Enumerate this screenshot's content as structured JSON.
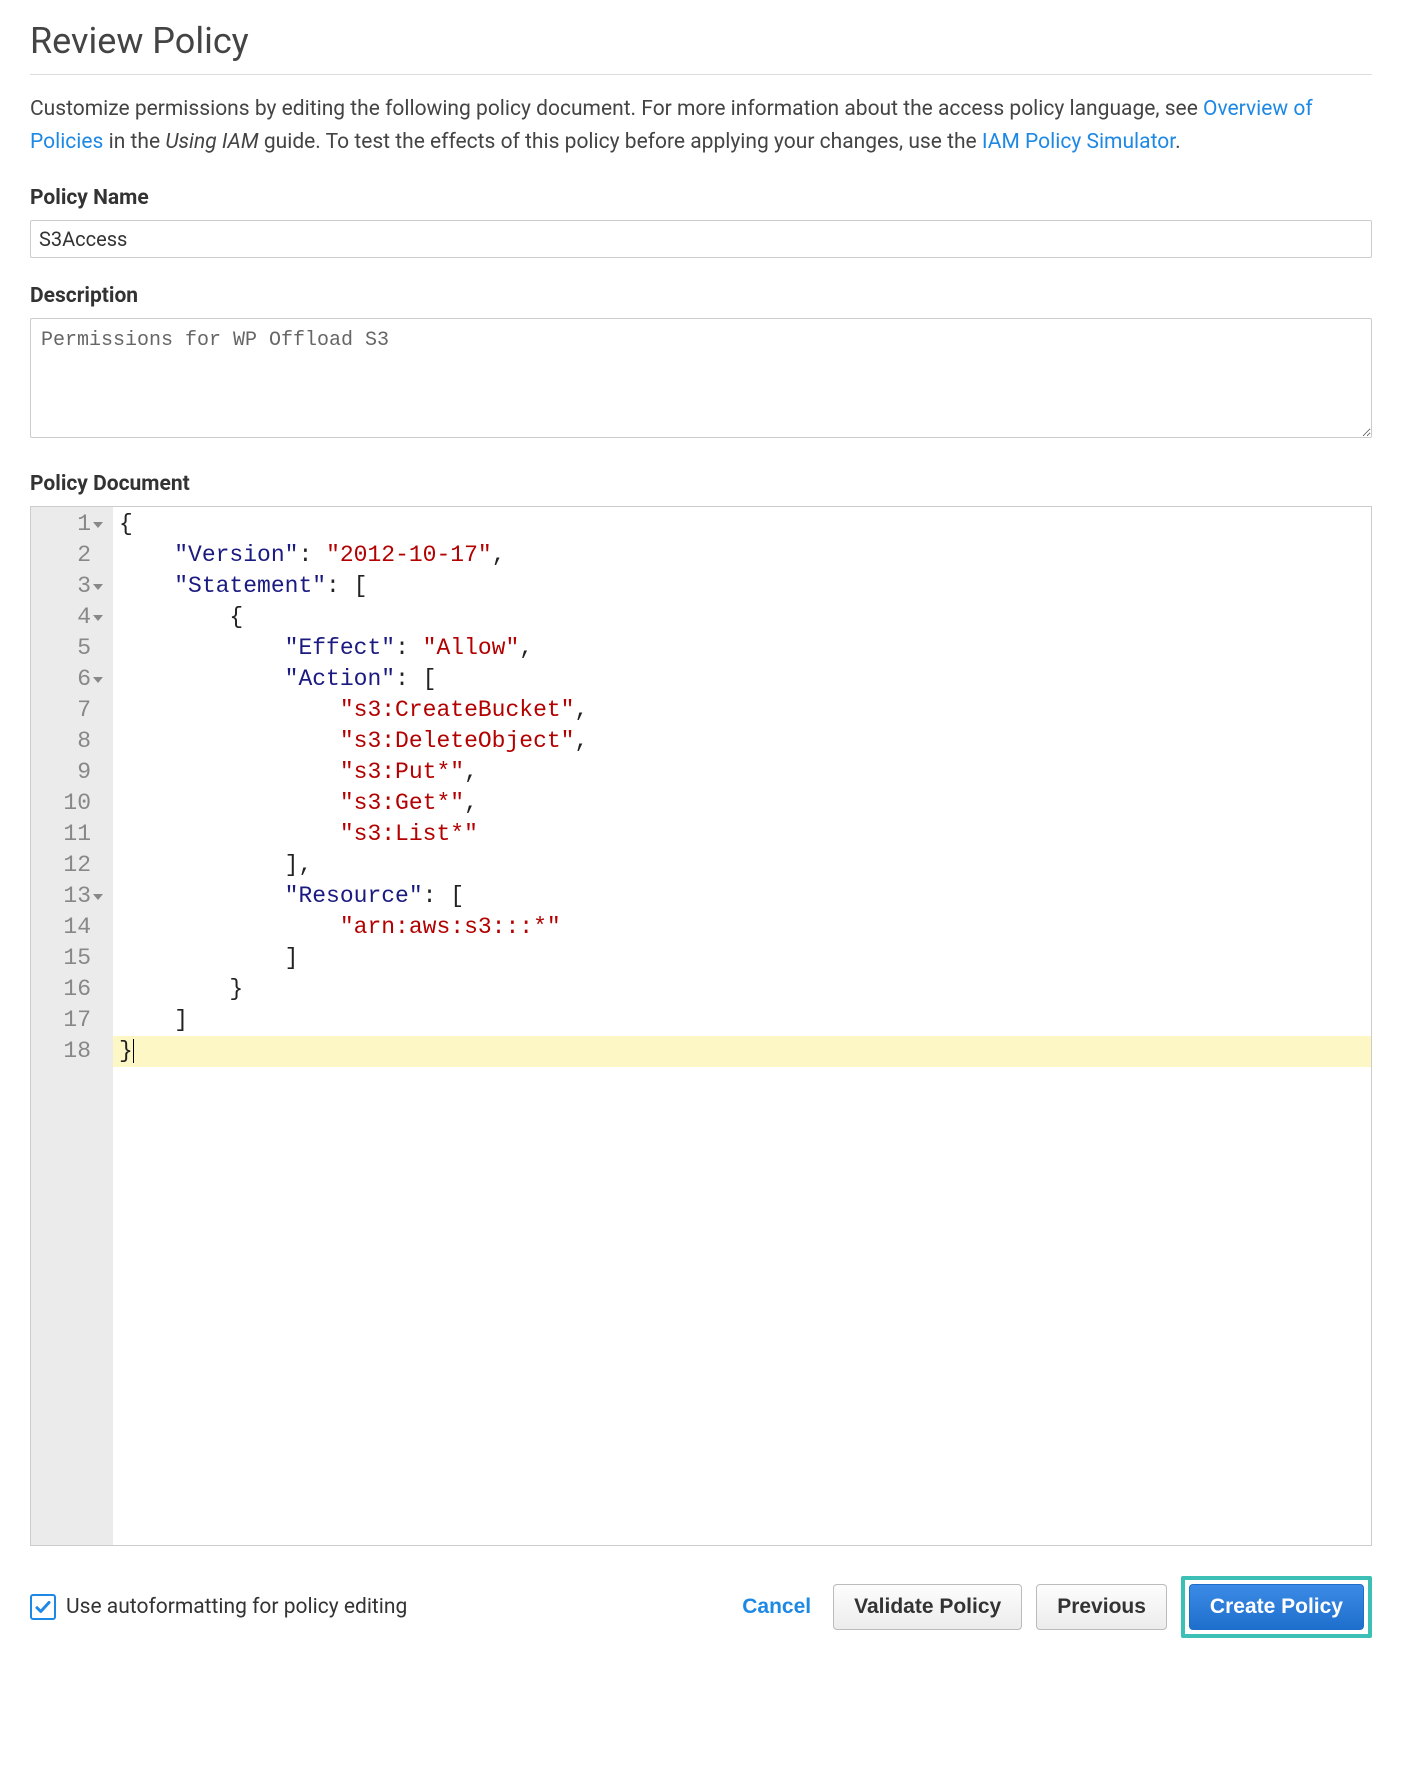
{
  "title": "Review Policy",
  "intro": {
    "text1": "Customize permissions by editing the following policy document. For more information about the access policy language, see ",
    "link1": "Overview of Policies",
    "text2": " in the ",
    "guide": "Using IAM",
    "text3": " guide. To test the effects of this policy before applying your changes, use the ",
    "link2": "IAM Policy Simulator",
    "text4": "."
  },
  "policyName": {
    "label": "Policy Name",
    "value": "S3Access"
  },
  "description": {
    "label": "Description",
    "value": "Permissions for WP Offload S3"
  },
  "policyDocument": {
    "label": "Policy Document",
    "lines": [
      {
        "n": 1,
        "fold": true,
        "tokens": [
          [
            "punc",
            "{"
          ]
        ]
      },
      {
        "n": 2,
        "fold": false,
        "tokens": [
          [
            "ws",
            "    "
          ],
          [
            "key",
            "\"Version\""
          ],
          [
            "punc",
            ": "
          ],
          [
            "str",
            "\"2012-10-17\""
          ],
          [
            "punc",
            ","
          ]
        ]
      },
      {
        "n": 3,
        "fold": true,
        "tokens": [
          [
            "ws",
            "    "
          ],
          [
            "key",
            "\"Statement\""
          ],
          [
            "punc",
            ": ["
          ]
        ]
      },
      {
        "n": 4,
        "fold": true,
        "tokens": [
          [
            "ws",
            "        "
          ],
          [
            "punc",
            "{"
          ]
        ]
      },
      {
        "n": 5,
        "fold": false,
        "tokens": [
          [
            "ws",
            "            "
          ],
          [
            "key",
            "\"Effect\""
          ],
          [
            "punc",
            ": "
          ],
          [
            "str",
            "\"Allow\""
          ],
          [
            "punc",
            ","
          ]
        ]
      },
      {
        "n": 6,
        "fold": true,
        "tokens": [
          [
            "ws",
            "            "
          ],
          [
            "key",
            "\"Action\""
          ],
          [
            "punc",
            ": ["
          ]
        ]
      },
      {
        "n": 7,
        "fold": false,
        "tokens": [
          [
            "ws",
            "                "
          ],
          [
            "str",
            "\"s3:CreateBucket\""
          ],
          [
            "punc",
            ","
          ]
        ]
      },
      {
        "n": 8,
        "fold": false,
        "tokens": [
          [
            "ws",
            "                "
          ],
          [
            "str",
            "\"s3:DeleteObject\""
          ],
          [
            "punc",
            ","
          ]
        ]
      },
      {
        "n": 9,
        "fold": false,
        "tokens": [
          [
            "ws",
            "                "
          ],
          [
            "str",
            "\"s3:Put*\""
          ],
          [
            "punc",
            ","
          ]
        ]
      },
      {
        "n": 10,
        "fold": false,
        "tokens": [
          [
            "ws",
            "                "
          ],
          [
            "str",
            "\"s3:Get*\""
          ],
          [
            "punc",
            ","
          ]
        ]
      },
      {
        "n": 11,
        "fold": false,
        "tokens": [
          [
            "ws",
            "                "
          ],
          [
            "str",
            "\"s3:List*\""
          ]
        ]
      },
      {
        "n": 12,
        "fold": false,
        "tokens": [
          [
            "ws",
            "            "
          ],
          [
            "punc",
            "],"
          ]
        ]
      },
      {
        "n": 13,
        "fold": true,
        "tokens": [
          [
            "ws",
            "            "
          ],
          [
            "key",
            "\"Resource\""
          ],
          [
            "punc",
            ": ["
          ]
        ]
      },
      {
        "n": 14,
        "fold": false,
        "tokens": [
          [
            "ws",
            "                "
          ],
          [
            "str",
            "\"arn:aws:s3:::*\""
          ]
        ]
      },
      {
        "n": 15,
        "fold": false,
        "tokens": [
          [
            "ws",
            "            "
          ],
          [
            "punc",
            "]"
          ]
        ]
      },
      {
        "n": 16,
        "fold": false,
        "tokens": [
          [
            "ws",
            "        "
          ],
          [
            "punc",
            "}"
          ]
        ]
      },
      {
        "n": 17,
        "fold": false,
        "tokens": [
          [
            "ws",
            "    "
          ],
          [
            "punc",
            "]"
          ]
        ]
      },
      {
        "n": 18,
        "fold": false,
        "tokens": [
          [
            "punc",
            "}"
          ]
        ]
      }
    ],
    "activeLine": 18
  },
  "footer": {
    "autoformat": "Use autoformatting for policy editing",
    "autoformatChecked": true,
    "cancel": "Cancel",
    "validate": "Validate Policy",
    "previous": "Previous",
    "create": "Create Policy"
  }
}
